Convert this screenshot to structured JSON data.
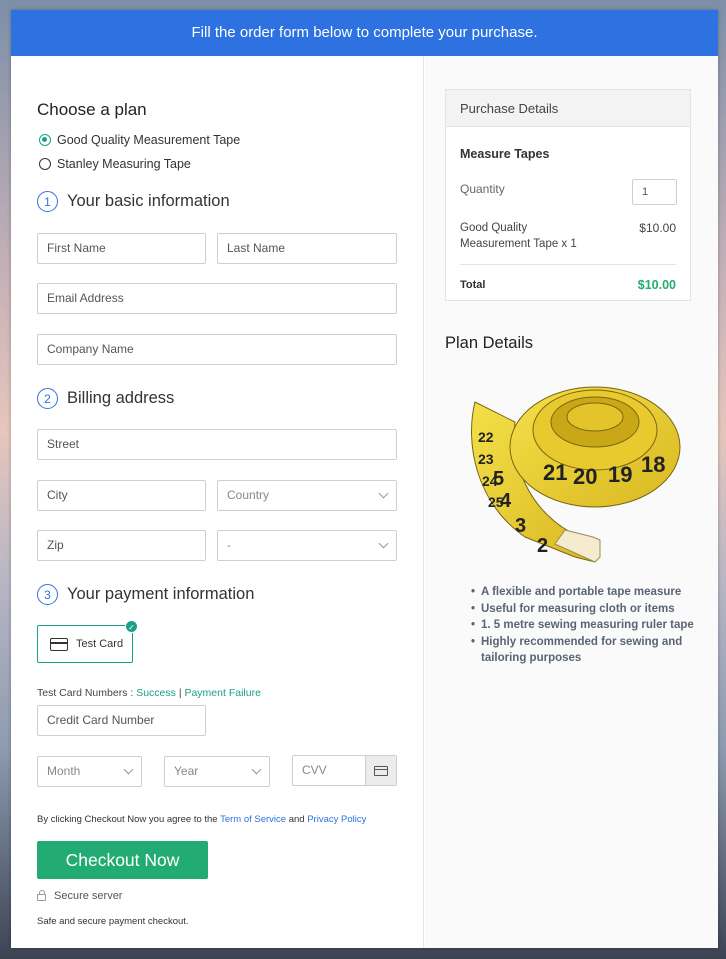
{
  "banner": {
    "text": "Fill the order form below to complete your purchase."
  },
  "plan": {
    "heading": "Choose a plan",
    "options": [
      {
        "label": "Good Quality Measurement Tape",
        "selected": true
      },
      {
        "label": "Stanley Measuring Tape",
        "selected": false
      }
    ]
  },
  "basic": {
    "number": "1",
    "heading": "Your basic information",
    "first_name": "First Name",
    "last_name": "Last Name",
    "email": "Email Address",
    "company": "Company Name"
  },
  "billing": {
    "number": "2",
    "heading": "Billing address",
    "street": "Street",
    "city": "City",
    "country": "Country",
    "zip": "Zip",
    "state": "-"
  },
  "payment": {
    "number": "3",
    "heading": "Your payment information",
    "card_tile": "Test Card",
    "test_prefix": "Test Card Numbers : ",
    "success": "Success",
    "separator": "|",
    "failure": "Payment Failure",
    "card_number": "Credit Card Number",
    "month": "Month",
    "year": "Year",
    "cvv": "CVV"
  },
  "agree": {
    "prefix": "By clicking Checkout Now you agree to the ",
    "terms": "Term of Service",
    "and": " and ",
    "privacy": "Privacy Policy"
  },
  "checkout": {
    "label": "Checkout Now"
  },
  "secure": {
    "label": "Secure server",
    "note": "Safe and secure payment checkout."
  },
  "purchase": {
    "heading": "Purchase Details",
    "product": "Measure Tapes",
    "quantity_label": "Quantity",
    "quantity_value": "1",
    "item": "Good Quality Measurement Tape x 1",
    "item_price": "$10.00",
    "total_label": "Total",
    "total_value": "$10.00"
  },
  "plan_details": {
    "heading": "Plan Details",
    "bullets": [
      "A flexible and portable tape measure",
      "Useful for measuring cloth or items",
      "1. 5 metre sewing measuring ruler tape",
      "Highly recommended for sewing and tailoring purposes"
    ],
    "tape_numbers": [
      "18",
      "19",
      "20",
      "21",
      "22",
      "23",
      "24",
      "25",
      "2",
      "3",
      "4",
      "5"
    ]
  },
  "colors": {
    "accent": "#2d72e0",
    "green": "#22ab73",
    "teal": "#1aa08a"
  }
}
